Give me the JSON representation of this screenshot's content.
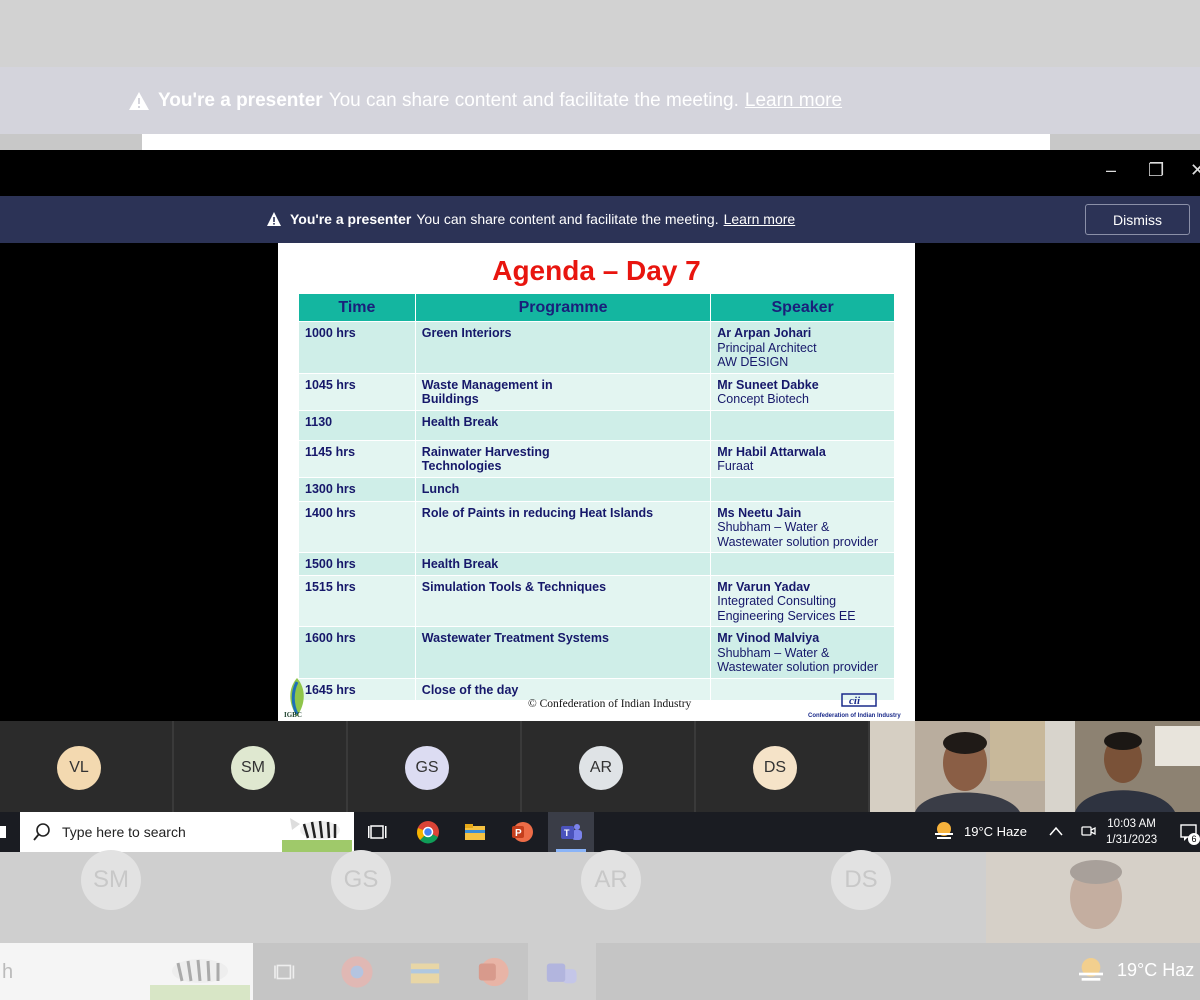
{
  "ghost_banner": {
    "bold": "You're a presenter",
    "text": "You can share content and facilitate the meeting.",
    "link": "Learn more"
  },
  "banner": {
    "bold": "You're a presenter",
    "text": "You can share content and facilitate the meeting.",
    "link": "Learn more",
    "dismiss": "Dismiss"
  },
  "window_controls": {
    "minimize": "–",
    "restore": "❐",
    "close": "✕"
  },
  "slide": {
    "title": "Agenda – Day 7",
    "headers": [
      "Time",
      "Programme",
      "Speaker"
    ],
    "rows": [
      {
        "time": "1000 hrs",
        "programme": "Green Interiors",
        "speaker_name": "Ar Arpan Johari",
        "speaker_org": "Principal Architect\nAW DESIGN"
      },
      {
        "time": "1045 hrs",
        "programme": "Waste Management in\nBuildings",
        "speaker_name": "Mr Suneet Dabke",
        "speaker_org": "Concept Biotech"
      },
      {
        "time": "1130",
        "programme": "Health Break",
        "speaker_name": "",
        "speaker_org": ""
      },
      {
        "time": "1145 hrs",
        "programme": "Rainwater Harvesting\nTechnologies",
        "speaker_name": "Mr Habil Attarwala",
        "speaker_org": "Furaat"
      },
      {
        "time": "1300 hrs",
        "programme": "Lunch",
        "speaker_name": "",
        "speaker_org": ""
      },
      {
        "time": "1400 hrs",
        "programme": "Role of Paints in reducing Heat Islands",
        "speaker_name": "Ms Neetu Jain",
        "speaker_org": "Shubham – Water &\nWastewater solution provider"
      },
      {
        "time": "1500 hrs",
        "programme": "Health Break",
        "speaker_name": "",
        "speaker_org": ""
      },
      {
        "time": "1515 hrs",
        "programme": "Simulation Tools & Techniques",
        "speaker_name": "Mr Varun Yadav",
        "speaker_org": "Integrated Consulting\nEngineering Services EE"
      },
      {
        "time": "1600 hrs",
        "programme": "Wastewater Treatment Systems",
        "speaker_name": "Mr Vinod Malviya",
        "speaker_org": "Shubham – Water &\nWastewater solution provider"
      },
      {
        "time": "1645 hrs",
        "programme": "Close of the day",
        "speaker_name": "",
        "speaker_org": ""
      }
    ],
    "copyright": "© Confederation of Indian Industry",
    "igbc_label": "IGBC",
    "cii_label": "Confederation of Indian Industry"
  },
  "participants": [
    {
      "initials": "VL",
      "color": "#f3d9b0"
    },
    {
      "initials": "SM",
      "color": "#dfe8d0"
    },
    {
      "initials": "GS",
      "color": "#dcdcf2"
    },
    {
      "initials": "AR",
      "color": "#dfe3e6"
    },
    {
      "initials": "DS",
      "color": "#f5e3c8"
    }
  ],
  "taskbar": {
    "search_placeholder": "Type here to search",
    "weather": "19°C  Haze",
    "time": "10:03 AM",
    "date": "1/31/2023",
    "notification_count": "6"
  },
  "ghost_participants": [
    "SM",
    "GS",
    "AR",
    "DS"
  ],
  "ghost_weather": "19°C  Haz",
  "ghost_search_char": "h"
}
